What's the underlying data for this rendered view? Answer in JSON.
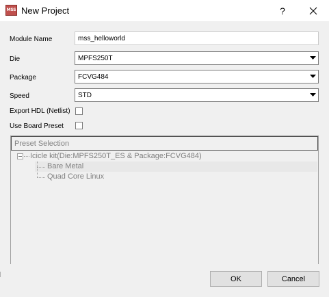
{
  "window": {
    "icon_text": "MSS",
    "title": "New Project",
    "help_label": "?"
  },
  "form": {
    "module_name": {
      "label": "Module Name",
      "value": "mss_helloworld"
    },
    "die": {
      "label": "Die",
      "value": "MPFS250T"
    },
    "package": {
      "label": "Package",
      "value": "FCVG484"
    },
    "speed": {
      "label": "Speed",
      "value": "STD"
    },
    "export_hdl": {
      "label": "Export HDL (Netlist)",
      "checked": false
    },
    "use_board_preset": {
      "label": "Use Board Preset",
      "checked": false
    }
  },
  "preset": {
    "header": "Preset Selection",
    "root": "Icicle kit(Die:MPFS250T_ES & Package:FCVG484)",
    "children": [
      "Bare Metal",
      "Quad Core Linux"
    ]
  },
  "buttons": {
    "ok": "OK",
    "cancel": "Cancel"
  }
}
